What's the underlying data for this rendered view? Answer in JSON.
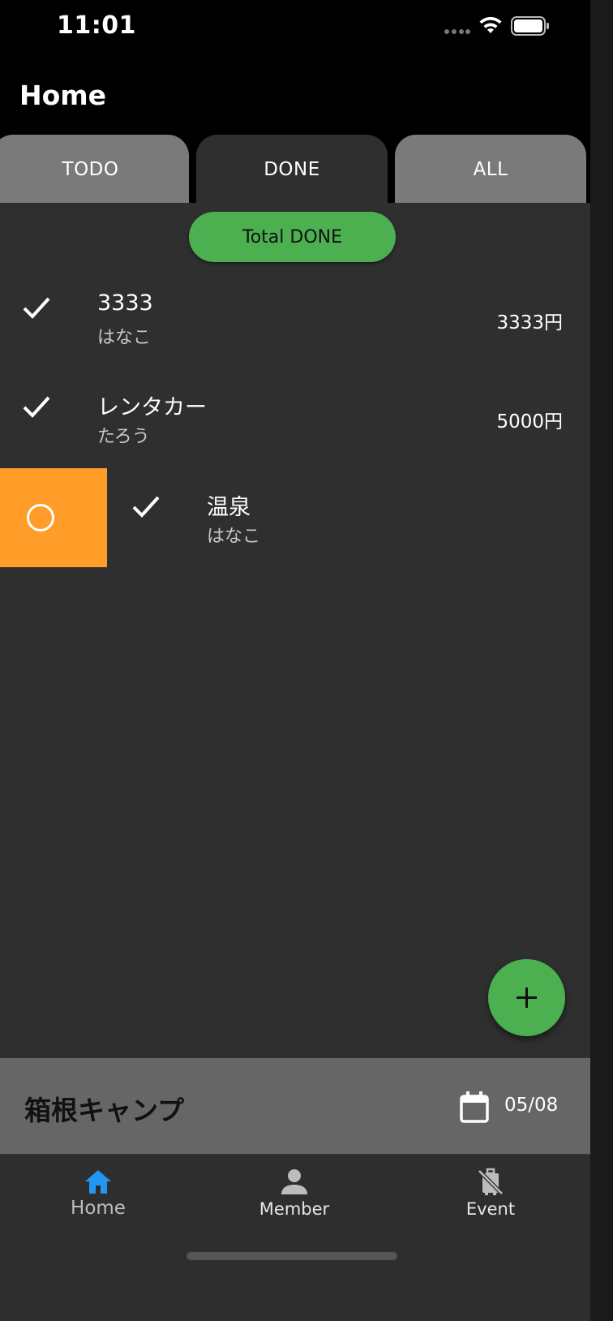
{
  "status_bar": {
    "time": "11:01",
    "wifi_icon": "wifi-icon",
    "battery_icon": "battery-icon"
  },
  "app_bar": {
    "title": "Home"
  },
  "tabs": [
    {
      "label": "TODO",
      "selected": false
    },
    {
      "label": "DONE",
      "selected": true
    },
    {
      "label": "ALL",
      "selected": false
    }
  ],
  "total_button": {
    "label": "Total DONE",
    "color": "#4caf50"
  },
  "items": [
    {
      "title": "3333",
      "member": "はなこ",
      "amount": "3333円",
      "done": true,
      "icon": "check-icon"
    },
    {
      "title": "レンタカー",
      "member": "たろう",
      "amount": "5000円",
      "done": true,
      "icon": "check-icon"
    },
    {
      "title": "温泉",
      "member": "はなこ",
      "amount": "",
      "done": true,
      "icon": "check-icon",
      "swipe_action": {
        "icon": "circle-icon",
        "color": "#ff9d28"
      }
    }
  ],
  "fab": {
    "icon": "plus-icon",
    "color": "#4caf50"
  },
  "event": {
    "name": "箱根キャンプ",
    "date": "05/08",
    "icon": "calendar-icon"
  },
  "bottom_nav": [
    {
      "label": "Home",
      "icon": "home-icon",
      "active": true,
      "color": "#2196f3"
    },
    {
      "label": "Member",
      "icon": "person-icon",
      "active": false
    },
    {
      "label": "Event",
      "icon": "no-luggage-icon",
      "active": false
    }
  ],
  "colors": {
    "background": "#2f2f2f",
    "tab_inactive": "#7a7a7a",
    "accent_green": "#4caf50",
    "swipe_orange": "#ff9d28"
  }
}
